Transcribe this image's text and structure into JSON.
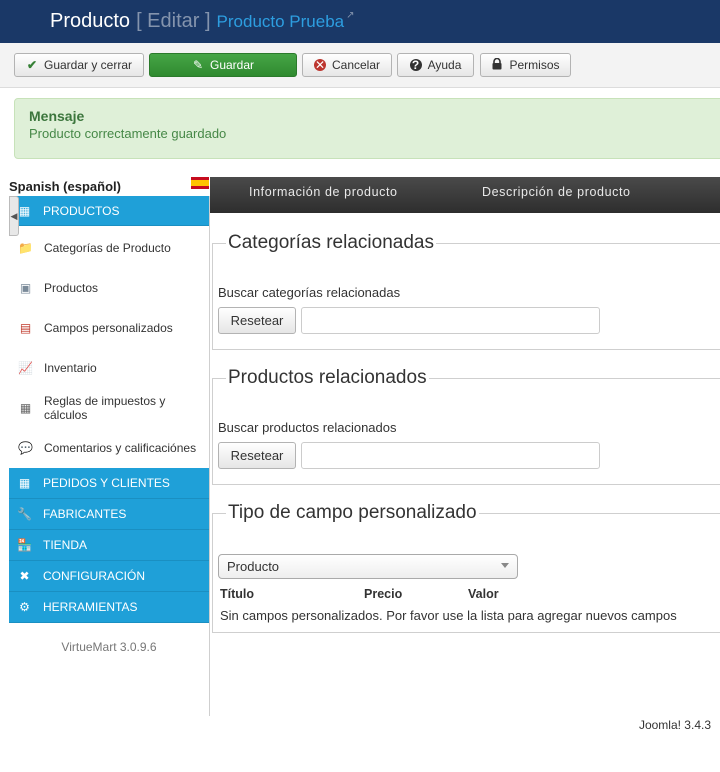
{
  "header": {
    "title": "Producto",
    "mode": "[ Editar ]",
    "product_link": "Producto Prueba"
  },
  "toolbar": {
    "save_close": "Guardar y cerrar",
    "save": "Guardar",
    "cancel": "Cancelar",
    "help": "Ayuda",
    "permissions": "Permisos"
  },
  "message": {
    "title": "Mensaje",
    "text": "Producto correctamente guardado"
  },
  "sidebar": {
    "language": "Spanish (español)",
    "sections": [
      {
        "label": "PRODUCTOS",
        "icon": "products-box-icon"
      },
      {
        "label": "PEDIDOS Y CLIENTES",
        "icon": "orders-icon"
      },
      {
        "label": "FABRICANTES",
        "icon": "wrench-icon"
      },
      {
        "label": "TIENDA",
        "icon": "shop-icon"
      },
      {
        "label": "CONFIGURACIÓN",
        "icon": "configuration-icon"
      },
      {
        "label": "HERRAMIENTAS",
        "icon": "tools-icon"
      }
    ],
    "items": [
      {
        "label": "Categorías de Producto",
        "icon": "folder-icon"
      },
      {
        "label": "Productos",
        "icon": "product-box-icon"
      },
      {
        "label": "Campos personalizados",
        "icon": "custom-fields-icon"
      },
      {
        "label": "Inventario",
        "icon": "inventory-chart-icon"
      },
      {
        "label": "Reglas de impuestos y cálculos",
        "icon": "calculator-icon"
      },
      {
        "label": "Comentarios y calificaciónes",
        "icon": "comment-bubble-icon"
      }
    ],
    "version": "VirtueMart 3.0.9.6"
  },
  "tabs": [
    {
      "label": "Información de producto"
    },
    {
      "label": "Descripción de producto"
    }
  ],
  "related_categories": {
    "legend": "Categorías relacionadas",
    "search_label": "Buscar categorías relacionadas",
    "reset": "Resetear",
    "value": ""
  },
  "related_products": {
    "legend": "Productos relacionados",
    "search_label": "Buscar productos relacionados",
    "reset": "Resetear",
    "value": ""
  },
  "custom_field": {
    "legend": "Tipo de campo personalizado",
    "selected": "Producto",
    "columns": [
      "Título",
      "Precio",
      "Valor"
    ],
    "empty_message": "Sin campos personalizados. Por favor use la lista para agregar nuevos campos"
  },
  "footer": {
    "joomla_version": "Joomla! 3.4.3"
  },
  "colors": {
    "header_bg": "#1a3867",
    "sidebar_active": "#1fa0d8",
    "save_green": "#46a546",
    "message_bg": "#dff0d8"
  }
}
